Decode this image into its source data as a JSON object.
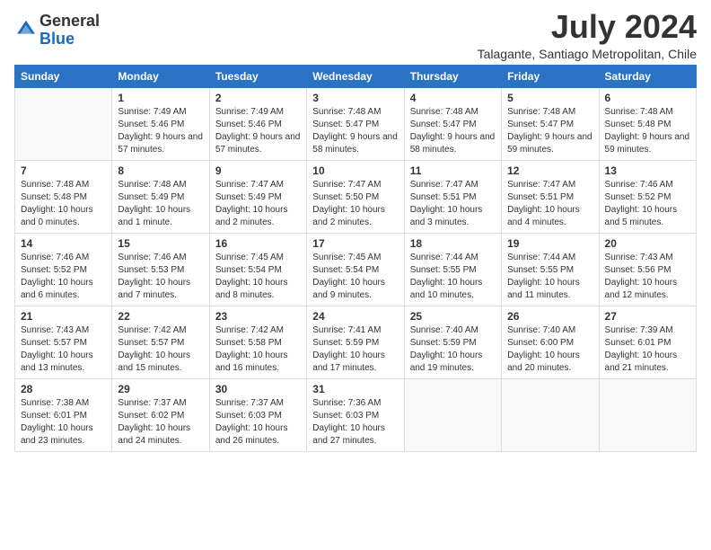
{
  "logo": {
    "line1": "General",
    "line2": "Blue"
  },
  "title": {
    "month_year": "July 2024",
    "location": "Talagante, Santiago Metropolitan, Chile"
  },
  "days_of_week": [
    "Sunday",
    "Monday",
    "Tuesday",
    "Wednesday",
    "Thursday",
    "Friday",
    "Saturday"
  ],
  "weeks": [
    [
      {
        "day": "",
        "sunrise": "",
        "sunset": "",
        "daylight": ""
      },
      {
        "day": "1",
        "sunrise": "Sunrise: 7:49 AM",
        "sunset": "Sunset: 5:46 PM",
        "daylight": "Daylight: 9 hours and 57 minutes."
      },
      {
        "day": "2",
        "sunrise": "Sunrise: 7:49 AM",
        "sunset": "Sunset: 5:46 PM",
        "daylight": "Daylight: 9 hours and 57 minutes."
      },
      {
        "day": "3",
        "sunrise": "Sunrise: 7:48 AM",
        "sunset": "Sunset: 5:47 PM",
        "daylight": "Daylight: 9 hours and 58 minutes."
      },
      {
        "day": "4",
        "sunrise": "Sunrise: 7:48 AM",
        "sunset": "Sunset: 5:47 PM",
        "daylight": "Daylight: 9 hours and 58 minutes."
      },
      {
        "day": "5",
        "sunrise": "Sunrise: 7:48 AM",
        "sunset": "Sunset: 5:47 PM",
        "daylight": "Daylight: 9 hours and 59 minutes."
      },
      {
        "day": "6",
        "sunrise": "Sunrise: 7:48 AM",
        "sunset": "Sunset: 5:48 PM",
        "daylight": "Daylight: 9 hours and 59 minutes."
      }
    ],
    [
      {
        "day": "7",
        "sunrise": "Sunrise: 7:48 AM",
        "sunset": "Sunset: 5:48 PM",
        "daylight": "Daylight: 10 hours and 0 minutes."
      },
      {
        "day": "8",
        "sunrise": "Sunrise: 7:48 AM",
        "sunset": "Sunset: 5:49 PM",
        "daylight": "Daylight: 10 hours and 1 minute."
      },
      {
        "day": "9",
        "sunrise": "Sunrise: 7:47 AM",
        "sunset": "Sunset: 5:49 PM",
        "daylight": "Daylight: 10 hours and 2 minutes."
      },
      {
        "day": "10",
        "sunrise": "Sunrise: 7:47 AM",
        "sunset": "Sunset: 5:50 PM",
        "daylight": "Daylight: 10 hours and 2 minutes."
      },
      {
        "day": "11",
        "sunrise": "Sunrise: 7:47 AM",
        "sunset": "Sunset: 5:51 PM",
        "daylight": "Daylight: 10 hours and 3 minutes."
      },
      {
        "day": "12",
        "sunrise": "Sunrise: 7:47 AM",
        "sunset": "Sunset: 5:51 PM",
        "daylight": "Daylight: 10 hours and 4 minutes."
      },
      {
        "day": "13",
        "sunrise": "Sunrise: 7:46 AM",
        "sunset": "Sunset: 5:52 PM",
        "daylight": "Daylight: 10 hours and 5 minutes."
      }
    ],
    [
      {
        "day": "14",
        "sunrise": "Sunrise: 7:46 AM",
        "sunset": "Sunset: 5:52 PM",
        "daylight": "Daylight: 10 hours and 6 minutes."
      },
      {
        "day": "15",
        "sunrise": "Sunrise: 7:46 AM",
        "sunset": "Sunset: 5:53 PM",
        "daylight": "Daylight: 10 hours and 7 minutes."
      },
      {
        "day": "16",
        "sunrise": "Sunrise: 7:45 AM",
        "sunset": "Sunset: 5:54 PM",
        "daylight": "Daylight: 10 hours and 8 minutes."
      },
      {
        "day": "17",
        "sunrise": "Sunrise: 7:45 AM",
        "sunset": "Sunset: 5:54 PM",
        "daylight": "Daylight: 10 hours and 9 minutes."
      },
      {
        "day": "18",
        "sunrise": "Sunrise: 7:44 AM",
        "sunset": "Sunset: 5:55 PM",
        "daylight": "Daylight: 10 hours and 10 minutes."
      },
      {
        "day": "19",
        "sunrise": "Sunrise: 7:44 AM",
        "sunset": "Sunset: 5:55 PM",
        "daylight": "Daylight: 10 hours and 11 minutes."
      },
      {
        "day": "20",
        "sunrise": "Sunrise: 7:43 AM",
        "sunset": "Sunset: 5:56 PM",
        "daylight": "Daylight: 10 hours and 12 minutes."
      }
    ],
    [
      {
        "day": "21",
        "sunrise": "Sunrise: 7:43 AM",
        "sunset": "Sunset: 5:57 PM",
        "daylight": "Daylight: 10 hours and 13 minutes."
      },
      {
        "day": "22",
        "sunrise": "Sunrise: 7:42 AM",
        "sunset": "Sunset: 5:57 PM",
        "daylight": "Daylight: 10 hours and 15 minutes."
      },
      {
        "day": "23",
        "sunrise": "Sunrise: 7:42 AM",
        "sunset": "Sunset: 5:58 PM",
        "daylight": "Daylight: 10 hours and 16 minutes."
      },
      {
        "day": "24",
        "sunrise": "Sunrise: 7:41 AM",
        "sunset": "Sunset: 5:59 PM",
        "daylight": "Daylight: 10 hours and 17 minutes."
      },
      {
        "day": "25",
        "sunrise": "Sunrise: 7:40 AM",
        "sunset": "Sunset: 5:59 PM",
        "daylight": "Daylight: 10 hours and 19 minutes."
      },
      {
        "day": "26",
        "sunrise": "Sunrise: 7:40 AM",
        "sunset": "Sunset: 6:00 PM",
        "daylight": "Daylight: 10 hours and 20 minutes."
      },
      {
        "day": "27",
        "sunrise": "Sunrise: 7:39 AM",
        "sunset": "Sunset: 6:01 PM",
        "daylight": "Daylight: 10 hours and 21 minutes."
      }
    ],
    [
      {
        "day": "28",
        "sunrise": "Sunrise: 7:38 AM",
        "sunset": "Sunset: 6:01 PM",
        "daylight": "Daylight: 10 hours and 23 minutes."
      },
      {
        "day": "29",
        "sunrise": "Sunrise: 7:37 AM",
        "sunset": "Sunset: 6:02 PM",
        "daylight": "Daylight: 10 hours and 24 minutes."
      },
      {
        "day": "30",
        "sunrise": "Sunrise: 7:37 AM",
        "sunset": "Sunset: 6:03 PM",
        "daylight": "Daylight: 10 hours and 26 minutes."
      },
      {
        "day": "31",
        "sunrise": "Sunrise: 7:36 AM",
        "sunset": "Sunset: 6:03 PM",
        "daylight": "Daylight: 10 hours and 27 minutes."
      },
      {
        "day": "",
        "sunrise": "",
        "sunset": "",
        "daylight": ""
      },
      {
        "day": "",
        "sunrise": "",
        "sunset": "",
        "daylight": ""
      },
      {
        "day": "",
        "sunrise": "",
        "sunset": "",
        "daylight": ""
      }
    ]
  ]
}
